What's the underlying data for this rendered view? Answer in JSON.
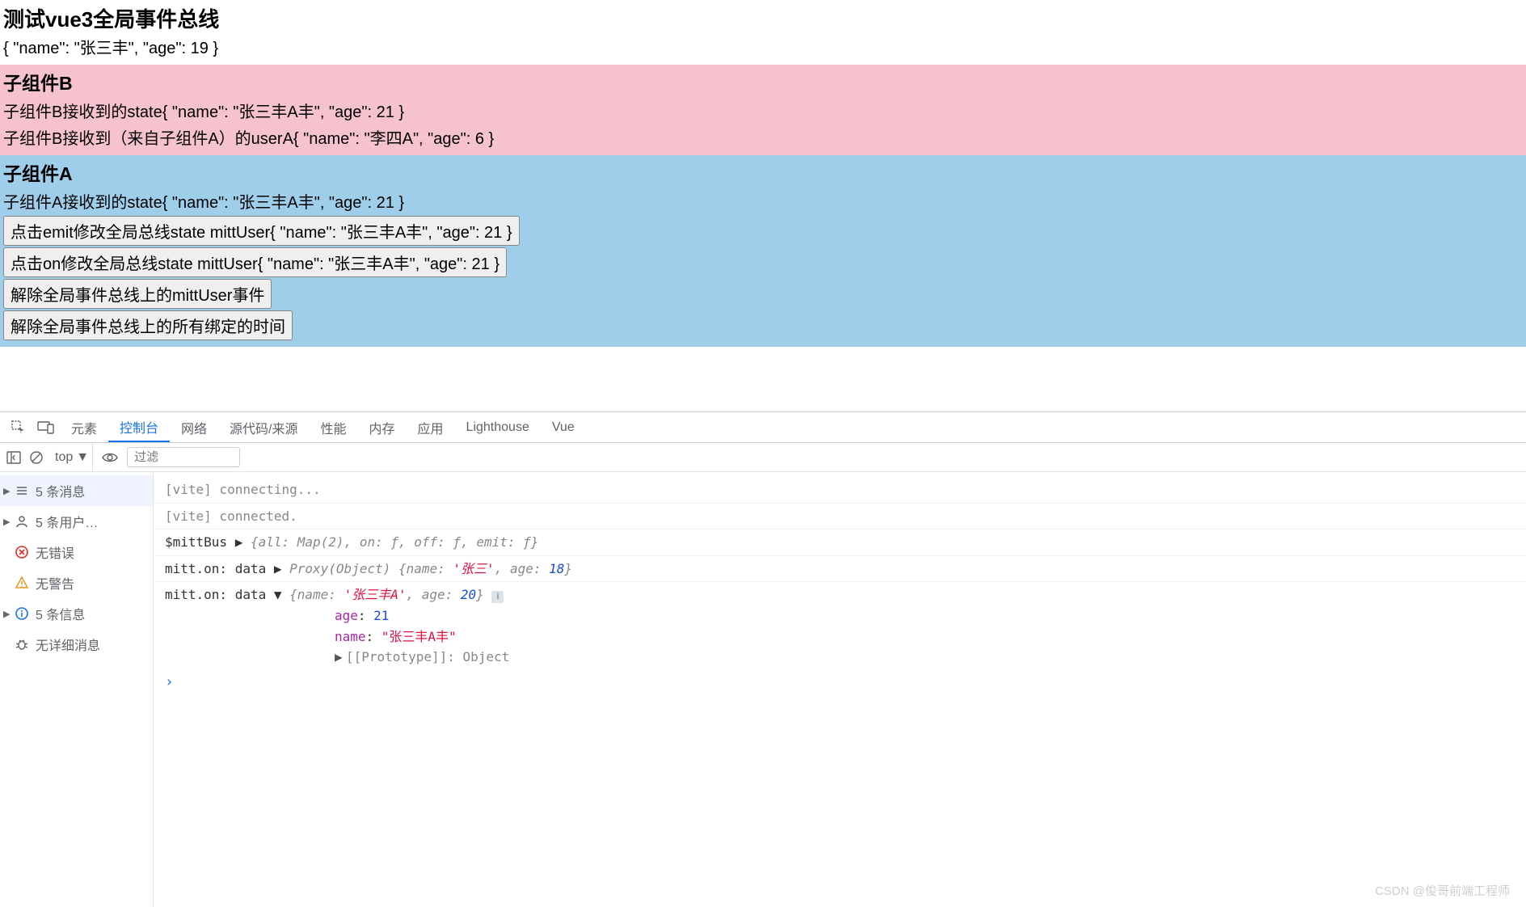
{
  "page": {
    "title": "测试vue3全局事件总线",
    "state_text": "{ \"name\": \"张三丰\", \"age\": 19 }",
    "compB": {
      "title": "子组件B",
      "line1": "子组件B接收到的state{ \"name\": \"张三丰A丰\", \"age\": 21 }",
      "line2": "子组件B接收到（来自子组件A）的userA{ \"name\": \"李四A\", \"age\": 6 }"
    },
    "compA": {
      "title": "子组件A",
      "line1": "子组件A接收到的state{ \"name\": \"张三丰A丰\", \"age\": 21 }",
      "btn1": "点击emit修改全局总线state mittUser{ \"name\": \"张三丰A丰\", \"age\": 21 }",
      "btn2": "点击on修改全局总线state mittUser{ \"name\": \"张三丰A丰\", \"age\": 21 }",
      "btn3": "解除全局事件总线上的mittUser事件",
      "btn4": "解除全局事件总线上的所有绑定的时间"
    }
  },
  "devtools": {
    "tabs": [
      "元素",
      "控制台",
      "网络",
      "源代码/来源",
      "性能",
      "内存",
      "应用",
      "Lighthouse",
      "Vue"
    ],
    "active_tab": "控制台",
    "context": "top",
    "filter_placeholder": "过滤",
    "sidebar": [
      {
        "label": "5 条消息",
        "icon": "list",
        "expandable": true
      },
      {
        "label": "5 条用户…",
        "icon": "user",
        "expandable": true
      },
      {
        "label": "无错误",
        "icon": "error",
        "expandable": false
      },
      {
        "label": "无警告",
        "icon": "warn",
        "expandable": false
      },
      {
        "label": "5 条信息",
        "icon": "info",
        "expandable": true
      },
      {
        "label": "无详细消息",
        "icon": "debug",
        "expandable": false
      }
    ],
    "console_lines": {
      "l1": "[vite] connecting...",
      "l2": "[vite] connected.",
      "l3_prefix": "$mittBus  ▶ ",
      "l3_obj": "{all: Map(2), on: ƒ, off: ƒ, emit: ƒ}",
      "l4_prefix": "mitt.on: data  ▶ ",
      "l4_proxy": "Proxy(Object) ",
      "l4_name": "'张三'",
      "l4_age": "18",
      "l5_prefix": "mitt.on: data  ▼ ",
      "l5_name": "'张三丰A'",
      "l5_age": "20",
      "l5_exp_age_k": "age",
      "l5_exp_age_v": "21",
      "l5_exp_name_k": "name",
      "l5_exp_name_v": "\"张三丰A丰\"",
      "l5_proto": "[[Prototype]]: Object"
    }
  },
  "watermark": "CSDN @俊哥前端工程师"
}
